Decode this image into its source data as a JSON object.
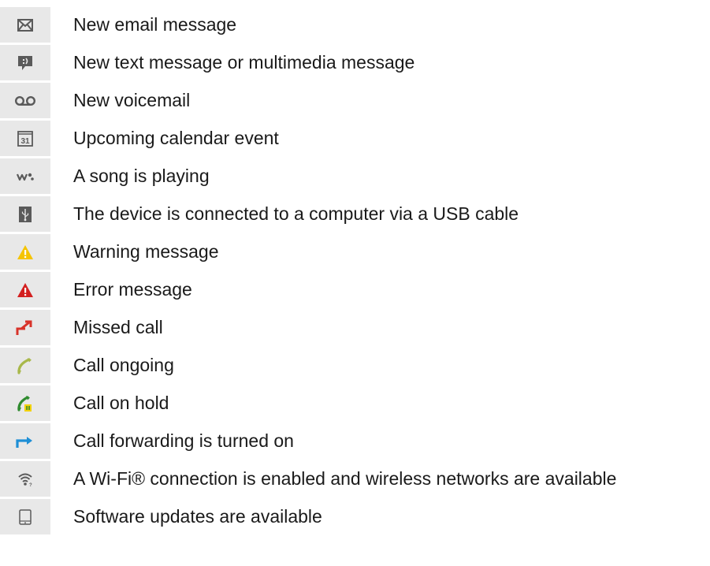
{
  "items": [
    {
      "icon": "email-icon",
      "label": "New email message"
    },
    {
      "icon": "text-message-icon",
      "label": "New text message or multimedia message"
    },
    {
      "icon": "voicemail-icon",
      "label": "New voicemail"
    },
    {
      "icon": "calendar-icon",
      "label": "Upcoming calendar event",
      "icon_text": "31"
    },
    {
      "icon": "walkman-icon",
      "label": "A song is playing"
    },
    {
      "icon": "usb-icon",
      "label": "The device is connected to a computer via a USB cable"
    },
    {
      "icon": "warning-icon",
      "label": "Warning message"
    },
    {
      "icon": "error-icon",
      "label": "Error message"
    },
    {
      "icon": "missed-call-icon",
      "label": "Missed call"
    },
    {
      "icon": "call-ongoing-icon",
      "label": "Call ongoing"
    },
    {
      "icon": "call-on-hold-icon",
      "label": "Call on hold"
    },
    {
      "icon": "call-forwarding-icon",
      "label": "Call forwarding is turned on"
    },
    {
      "icon": "wifi-icon",
      "label": "A Wi-Fi® connection is enabled and wireless networks are available"
    },
    {
      "icon": "software-update-icon",
      "label": "Software updates are available"
    }
  ],
  "colors": {
    "icon_background": "#e8e8e8",
    "text": "#1a1a1a",
    "icon_gray": "#5a5a5a",
    "warning_yellow": "#f5c400",
    "error_red": "#d32020",
    "missed_call_red": "#d8332a",
    "call_green": "#a8b84a",
    "hold_green": "#2e8b2e",
    "forward_blue": "#1e8fd6"
  }
}
